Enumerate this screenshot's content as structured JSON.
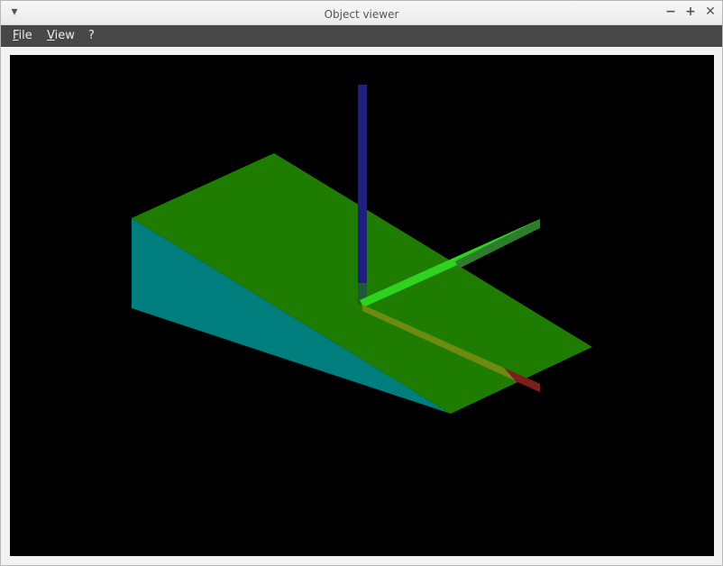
{
  "window": {
    "title": "Object viewer",
    "controls": {
      "menu_glyph": "▾",
      "minimize_glyph": "−",
      "maximize_glyph": "+",
      "close_glyph": "✕"
    }
  },
  "menubar": {
    "items": [
      {
        "mnemonic": "F",
        "rest": "ile"
      },
      {
        "mnemonic": "V",
        "rest": "iew"
      },
      {
        "mnemonic": "",
        "rest": "?"
      }
    ]
  },
  "scene": {
    "background": "#000000",
    "colors": {
      "wedge_top": "#1e7d00",
      "wedge_side": "#007d7d",
      "axis_z": "#1f1f7d",
      "axis_y": "#2fd21f",
      "axis_x": "#7d1e1e"
    }
  }
}
